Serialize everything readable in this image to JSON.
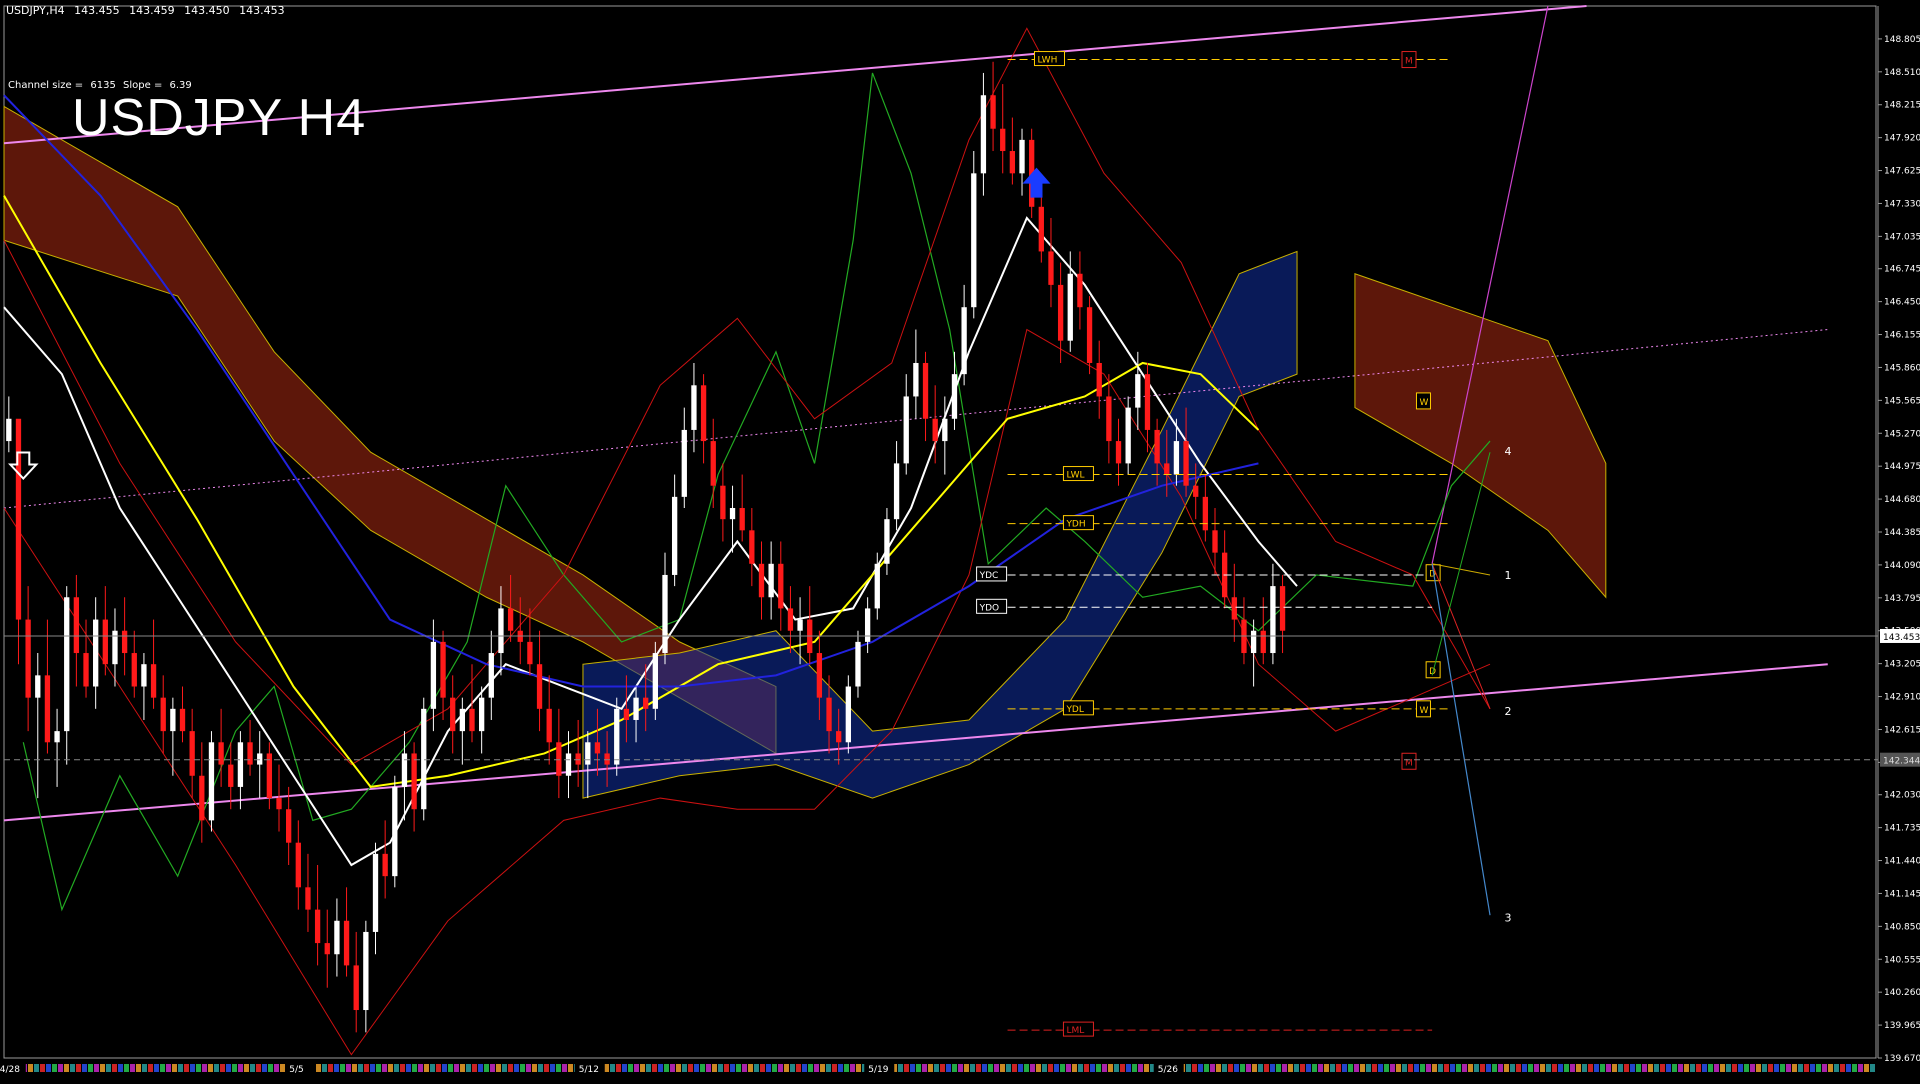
{
  "header": {
    "symbol_tf": "USDJPY,H4",
    "open": "143.455",
    "high": "143.459",
    "low": "143.450",
    "close": "143.453"
  },
  "channel_info": {
    "size_label": "Channel size =",
    "size_value": "6135",
    "slope_label": "Slope =",
    "slope_value": "6.39"
  },
  "title": "USDJPY H4",
  "chart_data": {
    "type": "candlestick",
    "symbol": "USDJPY",
    "timeframe": "H4",
    "ylim": [
      139.67,
      149.1
    ],
    "y_ticks": [
      "148.805",
      "148.510",
      "148.215",
      "147.920",
      "147.625",
      "147.330",
      "147.035",
      "146.745",
      "146.450",
      "146.155",
      "145.860",
      "145.565",
      "145.270",
      "144.975",
      "144.680",
      "144.385",
      "144.090",
      "143.795",
      "143.500",
      "143.205",
      "142.910",
      "142.615",
      "142.320",
      "142.030",
      "141.735",
      "141.440",
      "141.145",
      "140.850",
      "140.555",
      "140.260",
      "139.965",
      "139.670"
    ],
    "current_price": "143.453",
    "current_price_value": 143.453,
    "ref_price_label": "142.344",
    "ref_price_value": 142.344,
    "x_ticks": [
      "4/28",
      "5/5",
      "5/12",
      "5/19",
      "5/26"
    ],
    "x_tick_positions": [
      0.6,
      30.6,
      60.6,
      90.6,
      120.6
    ],
    "xlim": [
      0,
      194
    ],
    "candles": [
      [
        145.2,
        145.6,
        145.1,
        145.4
      ],
      [
        145.4,
        145.0,
        143.2,
        143.6
      ],
      [
        143.6,
        143.9,
        142.6,
        142.9
      ],
      [
        142.9,
        143.3,
        142.0,
        143.1
      ],
      [
        143.1,
        143.6,
        142.4,
        142.5
      ],
      [
        142.5,
        142.8,
        142.1,
        142.6
      ],
      [
        142.6,
        143.9,
        142.3,
        143.8
      ],
      [
        143.8,
        144.0,
        143.0,
        143.3
      ],
      [
        143.3,
        143.6,
        142.9,
        143.0
      ],
      [
        143.0,
        143.8,
        142.8,
        143.6
      ],
      [
        143.6,
        143.9,
        143.1,
        143.2
      ],
      [
        143.2,
        143.7,
        143.0,
        143.5
      ],
      [
        143.5,
        143.8,
        143.1,
        143.3
      ],
      [
        143.3,
        143.5,
        142.9,
        143.0
      ],
      [
        143.0,
        143.3,
        142.7,
        143.2
      ],
      [
        143.2,
        143.6,
        142.8,
        142.9
      ],
      [
        142.9,
        143.1,
        142.4,
        142.6
      ],
      [
        142.6,
        142.9,
        142.2,
        142.8
      ],
      [
        142.8,
        143.0,
        142.5,
        142.6
      ],
      [
        142.6,
        142.8,
        142.0,
        142.2
      ],
      [
        142.2,
        142.5,
        141.6,
        141.8
      ],
      [
        141.8,
        142.6,
        141.7,
        142.5
      ],
      [
        142.5,
        142.8,
        142.1,
        142.3
      ],
      [
        142.3,
        142.5,
        141.9,
        142.1
      ],
      [
        142.1,
        142.6,
        141.9,
        142.5
      ],
      [
        142.5,
        142.7,
        142.2,
        142.3
      ],
      [
        142.3,
        142.6,
        142.0,
        142.4
      ],
      [
        142.4,
        142.5,
        141.9,
        142.0
      ],
      [
        142.0,
        142.3,
        141.7,
        141.9
      ],
      [
        141.9,
        142.1,
        141.4,
        141.6
      ],
      [
        141.6,
        141.8,
        141.0,
        141.2
      ],
      [
        141.2,
        141.5,
        140.8,
        141.0
      ],
      [
        141.0,
        141.4,
        140.5,
        140.7
      ],
      [
        140.7,
        141.0,
        140.3,
        140.6
      ],
      [
        140.6,
        141.1,
        140.4,
        140.9
      ],
      [
        140.9,
        141.2,
        140.4,
        140.5
      ],
      [
        140.5,
        140.8,
        139.9,
        140.1
      ],
      [
        140.1,
        140.9,
        139.9,
        140.8
      ],
      [
        140.8,
        141.6,
        140.6,
        141.5
      ],
      [
        141.5,
        141.8,
        141.1,
        141.3
      ],
      [
        141.3,
        142.2,
        141.2,
        142.1
      ],
      [
        142.1,
        142.6,
        141.8,
        142.4
      ],
      [
        142.4,
        142.5,
        141.7,
        141.9
      ],
      [
        141.9,
        142.9,
        141.8,
        142.8
      ],
      [
        142.8,
        143.6,
        142.6,
        143.4
      ],
      [
        143.4,
        143.5,
        142.7,
        142.9
      ],
      [
        142.9,
        143.1,
        142.4,
        142.6
      ],
      [
        142.6,
        142.9,
        142.3,
        142.8
      ],
      [
        142.8,
        143.2,
        142.5,
        142.6
      ],
      [
        142.6,
        143.0,
        142.4,
        142.9
      ],
      [
        142.9,
        143.5,
        142.7,
        143.3
      ],
      [
        143.3,
        143.9,
        143.1,
        143.7
      ],
      [
        143.7,
        144.0,
        143.4,
        143.5
      ],
      [
        143.5,
        143.8,
        143.2,
        143.4
      ],
      [
        143.4,
        143.7,
        143.1,
        143.2
      ],
      [
        143.2,
        143.5,
        142.6,
        142.8
      ],
      [
        142.8,
        143.1,
        142.3,
        142.5
      ],
      [
        142.5,
        142.8,
        142.0,
        142.2
      ],
      [
        142.2,
        142.6,
        142.0,
        142.4
      ],
      [
        142.4,
        142.7,
        142.1,
        142.3
      ],
      [
        142.3,
        142.6,
        142.0,
        142.5
      ],
      [
        142.5,
        142.8,
        142.2,
        142.4
      ],
      [
        142.4,
        142.6,
        142.1,
        142.3
      ],
      [
        142.3,
        142.9,
        142.2,
        142.8
      ],
      [
        142.8,
        143.1,
        142.5,
        142.7
      ],
      [
        142.7,
        143.0,
        142.5,
        142.9
      ],
      [
        142.9,
        143.2,
        142.6,
        142.8
      ],
      [
        142.8,
        143.4,
        142.7,
        143.3
      ],
      [
        143.3,
        144.2,
        143.2,
        144.0
      ],
      [
        144.0,
        144.9,
        143.9,
        144.7
      ],
      [
        144.7,
        145.5,
        144.6,
        145.3
      ],
      [
        145.3,
        145.9,
        145.1,
        145.7
      ],
      [
        145.7,
        145.8,
        145.0,
        145.2
      ],
      [
        145.2,
        145.4,
        144.6,
        144.8
      ],
      [
        144.8,
        145.0,
        144.3,
        144.5
      ],
      [
        144.5,
        144.8,
        144.2,
        144.6
      ],
      [
        144.6,
        144.9,
        144.3,
        144.4
      ],
      [
        144.4,
        144.6,
        143.9,
        144.1
      ],
      [
        144.1,
        144.3,
        143.6,
        143.8
      ],
      [
        143.8,
        144.3,
        143.6,
        144.1
      ],
      [
        144.1,
        144.3,
        143.5,
        143.7
      ],
      [
        143.7,
        143.9,
        143.3,
        143.5
      ],
      [
        143.5,
        143.8,
        143.2,
        143.6
      ],
      [
        143.6,
        143.9,
        143.2,
        143.3
      ],
      [
        143.3,
        143.5,
        142.7,
        142.9
      ],
      [
        142.9,
        143.1,
        142.4,
        142.6
      ],
      [
        142.6,
        142.8,
        142.3,
        142.5
      ],
      [
        142.5,
        143.1,
        142.4,
        143.0
      ],
      [
        143.0,
        143.5,
        142.9,
        143.4
      ],
      [
        143.4,
        143.8,
        143.3,
        143.7
      ],
      [
        143.7,
        144.2,
        143.6,
        144.1
      ],
      [
        144.1,
        144.6,
        144.0,
        144.5
      ],
      [
        144.5,
        145.2,
        144.4,
        145.0
      ],
      [
        145.0,
        145.8,
        144.9,
        145.6
      ],
      [
        145.6,
        146.2,
        145.4,
        145.9
      ],
      [
        145.9,
        146.0,
        145.2,
        145.4
      ],
      [
        145.4,
        145.7,
        145.0,
        145.2
      ],
      [
        145.2,
        145.6,
        144.9,
        145.4
      ],
      [
        145.4,
        146.0,
        145.3,
        145.8
      ],
      [
        145.8,
        146.6,
        145.7,
        146.4
      ],
      [
        146.4,
        147.8,
        146.3,
        147.6
      ],
      [
        147.6,
        148.5,
        147.4,
        148.3
      ],
      [
        148.3,
        148.6,
        147.8,
        148.0
      ],
      [
        148.0,
        148.4,
        147.6,
        147.8
      ],
      [
        147.8,
        148.1,
        147.5,
        147.6
      ],
      [
        147.6,
        148.0,
        147.4,
        147.9
      ],
      [
        147.9,
        148.0,
        147.2,
        147.3
      ],
      [
        147.3,
        147.5,
        146.8,
        146.9
      ],
      [
        146.9,
        147.2,
        146.4,
        146.6
      ],
      [
        146.6,
        146.8,
        145.9,
        146.1
      ],
      [
        146.1,
        146.9,
        146.0,
        146.7
      ],
      [
        146.7,
        146.9,
        146.2,
        146.4
      ],
      [
        146.4,
        146.5,
        145.8,
        145.9
      ],
      [
        145.9,
        146.1,
        145.4,
        145.6
      ],
      [
        145.6,
        145.8,
        145.0,
        145.2
      ],
      [
        145.2,
        145.4,
        144.8,
        145.0
      ],
      [
        145.0,
        145.6,
        144.9,
        145.5
      ],
      [
        145.5,
        146.0,
        145.3,
        145.8
      ],
      [
        145.8,
        145.9,
        145.1,
        145.3
      ],
      [
        145.3,
        145.4,
        144.8,
        145.0
      ],
      [
        145.0,
        145.3,
        144.7,
        144.9
      ],
      [
        144.9,
        145.4,
        144.8,
        145.2
      ],
      [
        145.2,
        145.5,
        144.7,
        144.8
      ],
      [
        144.8,
        145.0,
        144.5,
        144.7
      ],
      [
        144.7,
        144.9,
        144.3,
        144.4
      ],
      [
        144.4,
        144.6,
        144.0,
        144.2
      ],
      [
        144.2,
        144.4,
        143.7,
        143.8
      ],
      [
        143.8,
        144.1,
        143.4,
        143.6
      ],
      [
        143.6,
        143.8,
        143.2,
        143.3
      ],
      [
        143.3,
        143.6,
        143.0,
        143.5
      ],
      [
        143.5,
        143.8,
        143.2,
        143.3
      ],
      [
        143.3,
        144.1,
        143.2,
        143.9
      ],
      [
        143.9,
        144.0,
        143.3,
        143.5
      ]
    ],
    "series": [
      {
        "name": "",
        "color": "#ffffff",
        "values": [
          [
            0,
            146.4
          ],
          [
            6,
            145.8
          ],
          [
            12,
            144.6
          ],
          [
            18,
            143.8
          ],
          [
            24,
            143.0
          ],
          [
            30,
            142.2
          ],
          [
            36,
            141.4
          ],
          [
            40,
            141.6
          ],
          [
            46,
            142.6
          ],
          [
            52,
            143.2
          ],
          [
            58,
            143.0
          ],
          [
            64,
            142.8
          ],
          [
            70,
            143.6
          ],
          [
            76,
            144.3
          ],
          [
            82,
            143.6
          ],
          [
            88,
            143.7
          ],
          [
            94,
            144.6
          ],
          [
            100,
            146.0
          ],
          [
            106,
            147.2
          ],
          [
            112,
            146.6
          ],
          [
            118,
            145.8
          ],
          [
            124,
            145.0
          ],
          [
            130,
            144.3
          ],
          [
            134,
            143.9
          ]
        ]
      },
      {
        "name": "",
        "color": "#ffff00",
        "values": [
          [
            0,
            147.4
          ],
          [
            10,
            145.9
          ],
          [
            20,
            144.5
          ],
          [
            30,
            143.0
          ],
          [
            38,
            142.1
          ],
          [
            46,
            142.2
          ],
          [
            56,
            142.4
          ],
          [
            64,
            142.7
          ],
          [
            74,
            143.2
          ],
          [
            84,
            143.4
          ],
          [
            94,
            144.4
          ],
          [
            104,
            145.4
          ],
          [
            112,
            145.6
          ],
          [
            118,
            145.9
          ],
          [
            124,
            145.8
          ],
          [
            130,
            145.3
          ]
        ]
      },
      {
        "name": "",
        "color": "#2222dd",
        "values": [
          [
            0,
            148.3
          ],
          [
            10,
            147.4
          ],
          [
            20,
            146.2
          ],
          [
            30,
            144.9
          ],
          [
            40,
            143.6
          ],
          [
            50,
            143.2
          ],
          [
            60,
            143.0
          ],
          [
            70,
            143.0
          ],
          [
            80,
            143.1
          ],
          [
            90,
            143.4
          ],
          [
            100,
            143.9
          ],
          [
            110,
            144.5
          ],
          [
            120,
            144.8
          ],
          [
            130,
            145.0
          ]
        ]
      }
    ],
    "levels": [
      {
        "label": "LWH",
        "value": 148.62,
        "color": "#ffcc00"
      },
      {
        "label": "LWL",
        "value": 144.9,
        "color": "#ffcc00"
      },
      {
        "label": "YDH",
        "value": 144.46,
        "color": "#ffcc00"
      },
      {
        "label": "YDC",
        "value": 144.0,
        "color": "#ffffff"
      },
      {
        "label": "YDO",
        "value": 143.71,
        "color": "#ffffff"
      },
      {
        "label": "YDL",
        "value": 142.8,
        "color": "#ffcc00"
      },
      {
        "label": "LML",
        "value": 139.92,
        "color": "#dd2222"
      }
    ],
    "markers": [
      {
        "label": "M",
        "value": 148.62,
        "color": "#dd2222"
      },
      {
        "label": "W",
        "value": 145.56,
        "color": "#ffcc00"
      },
      {
        "label": "D",
        "value": 144.02,
        "color": "#ffcc00"
      },
      {
        "label": "D",
        "value": 143.15,
        "color": "#ffcc00"
      },
      {
        "label": "W",
        "value": 142.8,
        "color": "#ffcc00"
      },
      {
        "label": "M",
        "value": 142.33,
        "color": "#dd2222"
      }
    ],
    "projections": [
      {
        "label": "1",
        "value": 144.0
      },
      {
        "label": "2",
        "value": 142.78
      },
      {
        "label": "3",
        "value": 140.93
      },
      {
        "label": "4",
        "value": 145.11
      }
    ],
    "colors": {
      "bull": "#ffffff",
      "bear": "#ff1a1a",
      "channel": "#ee88ee",
      "cloud_bear": "#aa2a12",
      "cloud_bull": "#1030a0",
      "green_line": "#22aa22",
      "band": "#cc1111",
      "purple": "#cc44cc",
      "projection": "#4488cc"
    }
  }
}
